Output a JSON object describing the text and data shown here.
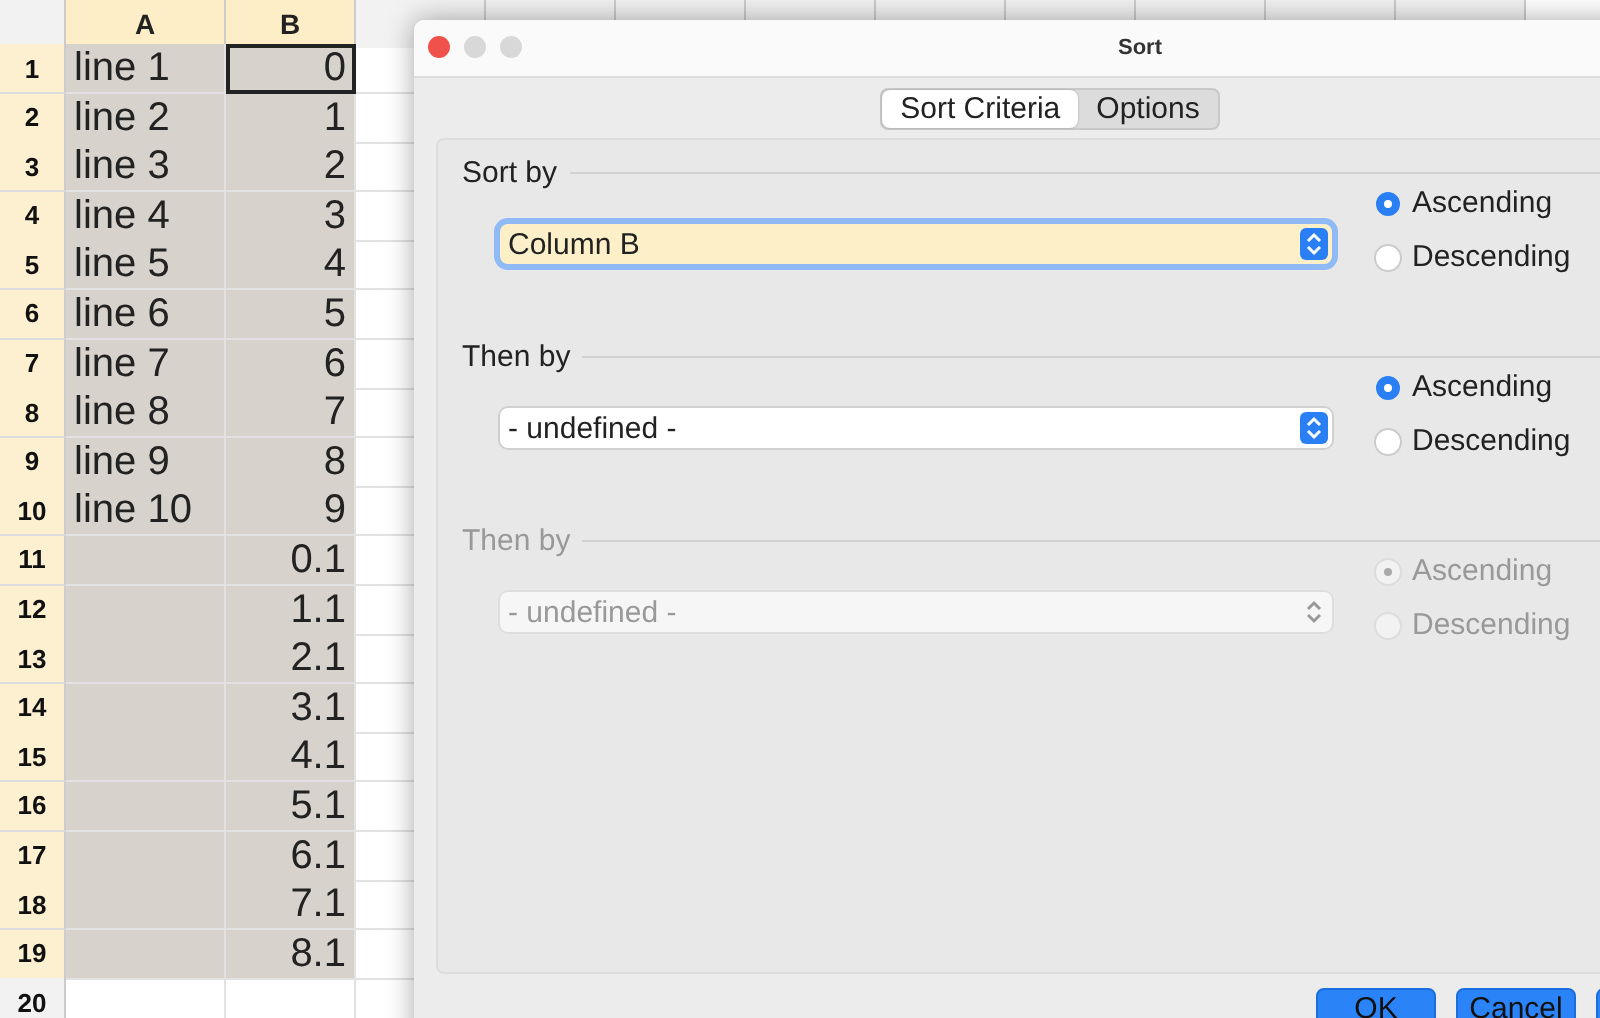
{
  "spreadsheet": {
    "columns": [
      {
        "label": "A",
        "selected": true
      },
      {
        "label": "B",
        "selected": true
      }
    ],
    "rows": [
      {
        "number": "1",
        "a": "line 1",
        "b": "0",
        "selected": true,
        "active": true
      },
      {
        "number": "2",
        "a": "line 2",
        "b": "1",
        "selected": true,
        "active": false
      },
      {
        "number": "3",
        "a": "line 3",
        "b": "2",
        "selected": true,
        "active": false
      },
      {
        "number": "4",
        "a": "line 4",
        "b": "3",
        "selected": true,
        "active": false
      },
      {
        "number": "5",
        "a": "line 5",
        "b": "4",
        "selected": true,
        "active": false
      },
      {
        "number": "6",
        "a": "line 6",
        "b": "5",
        "selected": true,
        "active": false
      },
      {
        "number": "7",
        "a": "line 7",
        "b": "6",
        "selected": true,
        "active": false
      },
      {
        "number": "8",
        "a": "line 8",
        "b": "7",
        "selected": true,
        "active": false
      },
      {
        "number": "9",
        "a": "line 9",
        "b": "8",
        "selected": true,
        "active": false
      },
      {
        "number": "10",
        "a": "line 10",
        "b": "9",
        "selected": true,
        "active": false
      },
      {
        "number": "11",
        "b": "0.1",
        "selected": true,
        "active": false
      },
      {
        "number": "12",
        "b": "1.1",
        "selected": true,
        "active": false
      },
      {
        "number": "13",
        "b": "2.1",
        "selected": true,
        "active": false
      },
      {
        "number": "14",
        "b": "3.1",
        "selected": true,
        "active": false
      },
      {
        "number": "15",
        "b": "4.1",
        "selected": true,
        "active": false
      },
      {
        "number": "16",
        "b": "5.1",
        "selected": true,
        "active": false
      },
      {
        "number": "17",
        "b": "6.1",
        "selected": true,
        "active": false
      },
      {
        "number": "18",
        "b": "7.1",
        "selected": true,
        "active": false
      },
      {
        "number": "19",
        "b": "8.1",
        "selected": true,
        "active": false
      },
      {
        "number": "20",
        "selected": false,
        "active": false
      }
    ]
  },
  "dialog": {
    "title": "Sort",
    "tabs": [
      {
        "label": "Sort Criteria",
        "selected": true
      },
      {
        "label": "Options",
        "selected": false
      }
    ],
    "criteria": [
      {
        "label": "Sort by",
        "value": "Column B",
        "focused": true,
        "disabled": false,
        "order": [
          {
            "label": "Ascending",
            "selected": true
          },
          {
            "label": "Descending",
            "selected": false
          }
        ]
      },
      {
        "label": "Then by",
        "value": "- undefined -",
        "focused": false,
        "disabled": false,
        "order": [
          {
            "label": "Ascending",
            "selected": true
          },
          {
            "label": "Descending",
            "selected": false
          }
        ]
      },
      {
        "label": "Then by",
        "value": "- undefined -",
        "focused": false,
        "disabled": true,
        "order": [
          {
            "label": "Ascending",
            "selected": true
          },
          {
            "label": "Descending",
            "selected": false
          }
        ]
      }
    ],
    "buttons": [
      {
        "label": "OK"
      },
      {
        "label": "Cancel"
      }
    ]
  }
}
